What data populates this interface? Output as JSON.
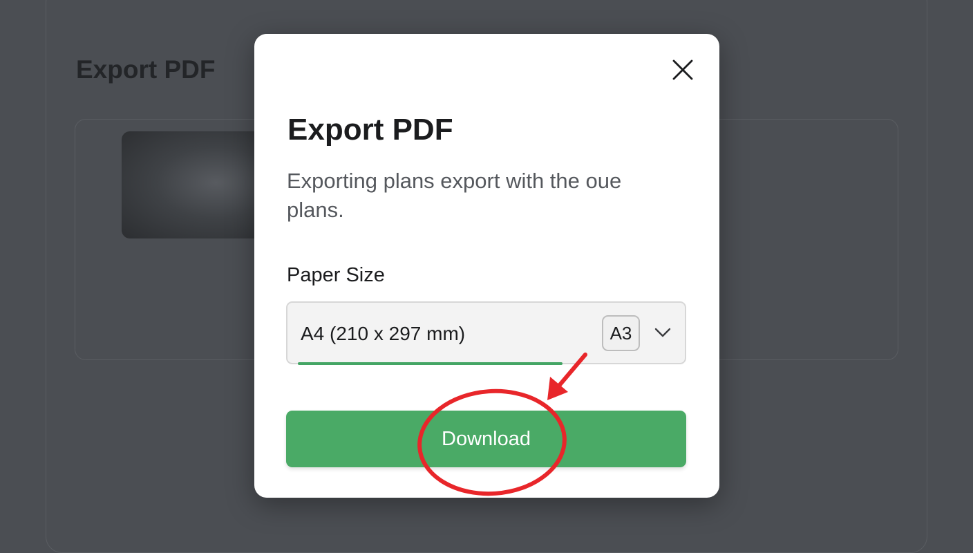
{
  "background": {
    "title": "Export PDF"
  },
  "modal": {
    "close_icon": "close-icon",
    "title": "Export PDF",
    "description": "Exporting plans export with the oue plans.",
    "paper_size": {
      "label": "Paper Size",
      "selected_value": "A4 (210 x 297 mm)",
      "badge": "A3",
      "dropdown_icon": "chevron-down-icon"
    },
    "download_label": "Download"
  },
  "colors": {
    "accent_green": "#4aaa66",
    "annotation_red": "#e8262a",
    "overlay": "#4b4e53"
  }
}
